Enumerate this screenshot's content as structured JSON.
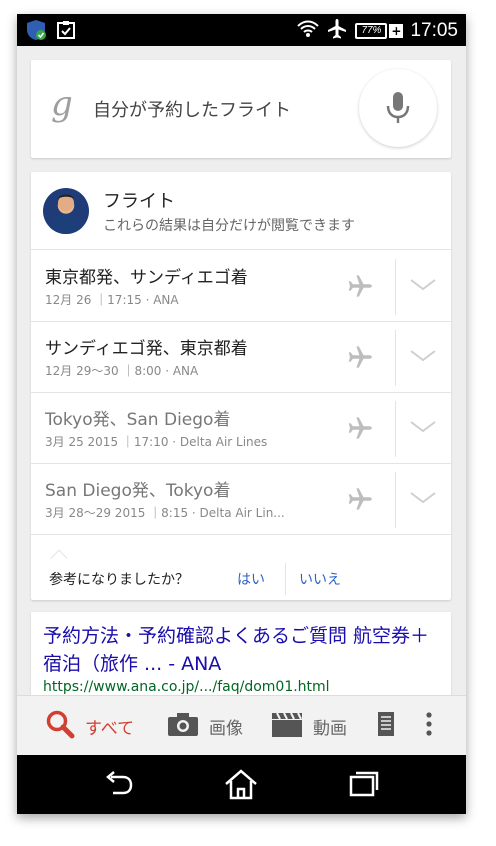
{
  "status_bar": {
    "battery": "77%",
    "time": "17:05",
    "left_icons": [
      "shield-check-icon",
      "clipboard-check-icon"
    ],
    "right_icons": [
      "wifi-icon",
      "airplane-mode-icon",
      "battery-icon",
      "charging-plus-icon"
    ]
  },
  "search": {
    "logo": "g",
    "query": "自分が予約したフライト",
    "mic_icon": "microphone-icon"
  },
  "flight_card": {
    "title": "フライト",
    "subtitle": "これらの結果は自分だけが閲覧できます",
    "flights": [
      {
        "title": "東京都発、サンディエゴ着",
        "detail": "12月 26 ｜17:15 · ANA",
        "past": false
      },
      {
        "title": "サンディエゴ発、東京都着",
        "detail": "12月 29〜30 ｜8:00 · ANA",
        "past": false
      },
      {
        "title": "Tokyo発、San Diego着",
        "detail": "3月 25 2015 ｜17:10 · Delta Air Lines",
        "past": true
      },
      {
        "title": "San Diego発、Tokyo着",
        "detail": "3月 28〜29 2015 ｜8:15 · Delta Air Lin...",
        "past": true
      }
    ],
    "feedback": {
      "question": "参考になりましたか？",
      "yes": "はい",
      "no": "いいえ"
    }
  },
  "result": {
    "title": "予約方法・予約確認よくあるご質問 航空券＋宿泊（旅作 ... - ANA",
    "url": "https://www.ana.co.jp/.../faq/dom01.html"
  },
  "tabs": [
    {
      "label": "すべて",
      "icon": "search-icon",
      "active": true
    },
    {
      "label": "画像",
      "icon": "camera-icon",
      "active": false
    },
    {
      "label": "動画",
      "icon": "clapperboard-icon",
      "active": false
    }
  ],
  "colors": {
    "accent_red": "#d23f31",
    "link_blue": "#1a0dab",
    "url_green": "#006621",
    "feedback_blue": "#2a62c8"
  }
}
